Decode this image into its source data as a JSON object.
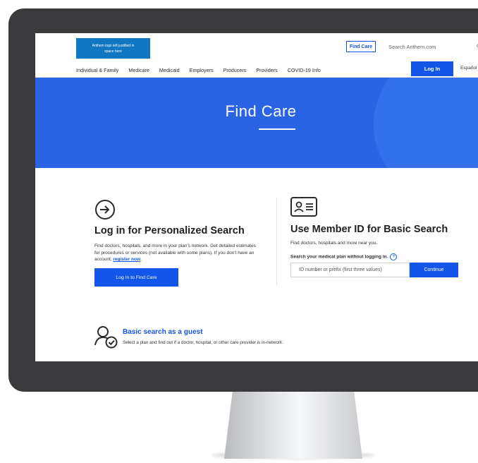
{
  "header": {
    "logo_text": "Anthem logo left justified in space here",
    "find_care_button": "Find Care",
    "search_placeholder": "Search Anthem.com",
    "nav": [
      "Individual & Family",
      "Medicare",
      "Medicaid",
      "Employers",
      "Producers",
      "Providers",
      "COVID-19 Info"
    ],
    "login_button": "Log In",
    "language": "Español"
  },
  "hero": {
    "title": "Find Care"
  },
  "login_section": {
    "title": "Log in for Personalized Search",
    "description": "Find doctors, hospitals, and more in your plan's network. Get detailed estimates for procedures or services (not available with some plans). If you don't have an account,",
    "register_link": "register now",
    "button": "Log In to Find Care"
  },
  "member_section": {
    "title": "Use Member ID for Basic Search",
    "description": "Find doctors, hospitals and more near you.",
    "label": "Search your medical plan without logging in.",
    "input_placeholder": "ID number or prefix (first three values)",
    "button": "Continue"
  },
  "guest_section": {
    "title": "Basic search as a guest",
    "description": "Select a plan and find out if a doctor, hospital, or other care provider is in-network."
  },
  "colors": {
    "brand_blue": "#1355e9",
    "hero_blue": "#2a63e3",
    "logo_blue": "#1177c2",
    "monitor_frame": "#3a3a3c"
  }
}
